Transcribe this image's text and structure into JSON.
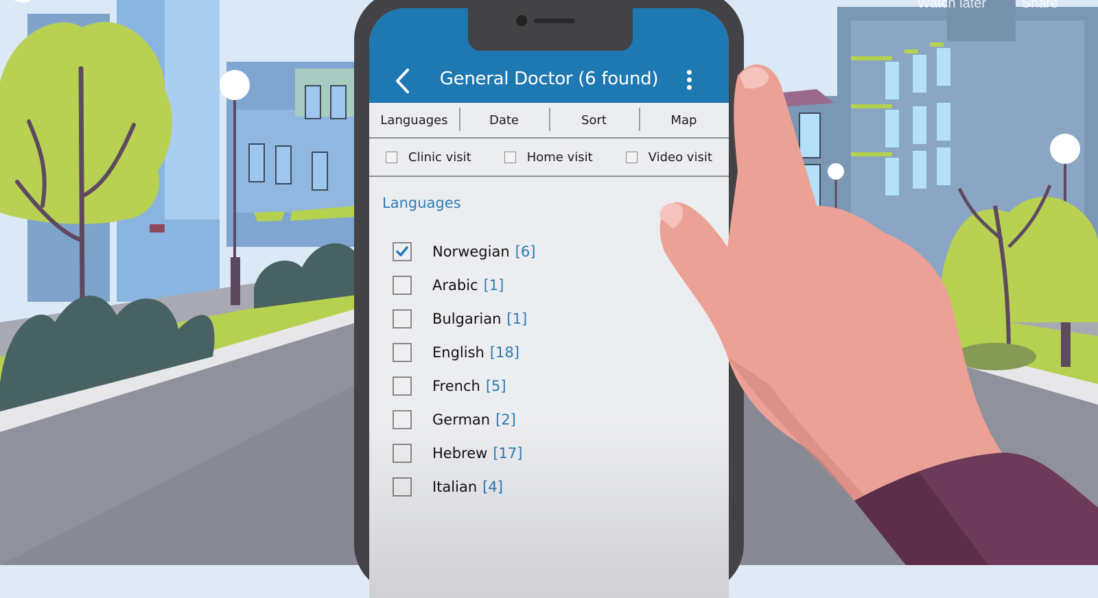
{
  "video_overlay": {
    "watch_later_label": "Watch later",
    "share_label": "Share"
  },
  "app": {
    "title": "General Doctor (6 found)",
    "back_icon": "chevron-left-icon",
    "menu_icon": "more-vertical-icon",
    "accent_color": "#1e78b2",
    "link_color": "#2b7bb5"
  },
  "tabs": [
    {
      "label": "Languages"
    },
    {
      "label": "Date"
    },
    {
      "label": "Sort"
    },
    {
      "label": "Map"
    }
  ],
  "visit_types": [
    {
      "label": "Clinic visit",
      "checked": false
    },
    {
      "label": "Home visit",
      "checked": false
    },
    {
      "label": "Video visit",
      "checked": false
    }
  ],
  "languages_section": {
    "title": "Languages",
    "items": [
      {
        "name": "Norwegian",
        "count": "[6]",
        "checked": true
      },
      {
        "name": "Arabic",
        "count": "[1]",
        "checked": false
      },
      {
        "name": "Bulgarian",
        "count": "[1]",
        "checked": false
      },
      {
        "name": "English",
        "count": "[18]",
        "checked": false
      },
      {
        "name": "French",
        "count": "[5]",
        "checked": false
      },
      {
        "name": "German",
        "count": "[2]",
        "checked": false
      },
      {
        "name": "Hebrew",
        "count": "[17]",
        "checked": false
      },
      {
        "name": "Italian",
        "count": "[4]",
        "checked": false
      }
    ]
  }
}
